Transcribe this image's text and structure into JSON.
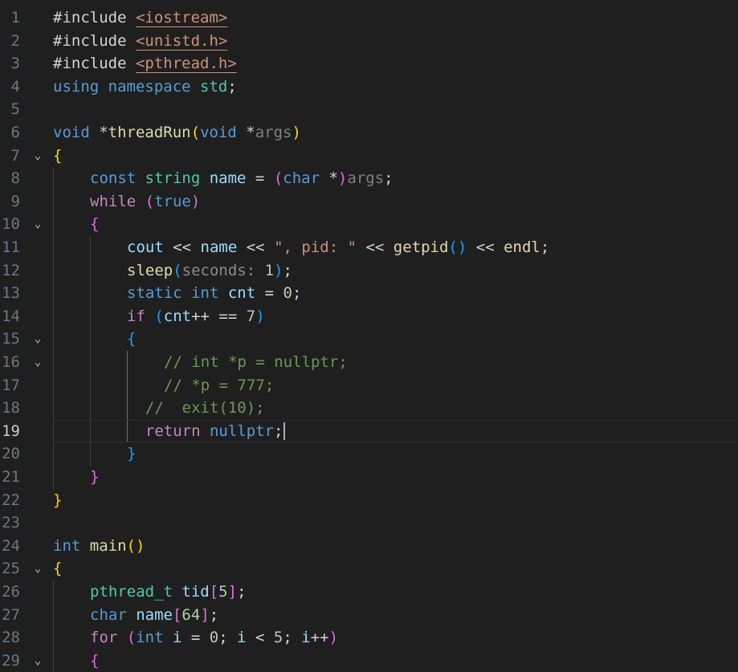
{
  "editor": {
    "language": "cpp",
    "cursor_line": 19,
    "lines": [
      {
        "n": "1",
        "fold": "",
        "indent": 0,
        "tokens": [
          {
            "t": "#include ",
            "c": "plain"
          },
          {
            "t": "<iostream>",
            "c": "inc"
          }
        ]
      },
      {
        "n": "2",
        "fold": "",
        "indent": 0,
        "tokens": [
          {
            "t": "#include ",
            "c": "plain"
          },
          {
            "t": "<unistd.h>",
            "c": "inc"
          }
        ]
      },
      {
        "n": "3",
        "fold": "",
        "indent": 0,
        "tokens": [
          {
            "t": "#include ",
            "c": "plain"
          },
          {
            "t": "<pthread.h>",
            "c": "inc"
          }
        ]
      },
      {
        "n": "4",
        "fold": "",
        "indent": 0,
        "tokens": [
          {
            "t": "using ",
            "c": "kw"
          },
          {
            "t": "namespace ",
            "c": "kw"
          },
          {
            "t": "std",
            "c": "ty"
          },
          {
            "t": ";",
            "c": "plain"
          }
        ]
      },
      {
        "n": "5",
        "fold": "",
        "indent": 0,
        "tokens": []
      },
      {
        "n": "6",
        "fold": "",
        "indent": 0,
        "tokens": [
          {
            "t": "void ",
            "c": "kw"
          },
          {
            "t": "*",
            "c": "plain"
          },
          {
            "t": "threadRun",
            "c": "fn"
          },
          {
            "t": "(",
            "c": "b1"
          },
          {
            "t": "void ",
            "c": "kw"
          },
          {
            "t": "*",
            "c": "plain"
          },
          {
            "t": "args",
            "c": "par"
          },
          {
            "t": ")",
            "c": "b1"
          }
        ]
      },
      {
        "n": "7",
        "fold": "⌄",
        "indent": 0,
        "tokens": [
          {
            "t": "{",
            "c": "b1"
          }
        ]
      },
      {
        "n": "8",
        "fold": "",
        "indent": 1,
        "tokens": [
          {
            "t": "const ",
            "c": "kw"
          },
          {
            "t": "string ",
            "c": "ty"
          },
          {
            "t": "name ",
            "c": "id"
          },
          {
            "t": "= ",
            "c": "plain"
          },
          {
            "t": "(",
            "c": "b2"
          },
          {
            "t": "char ",
            "c": "kw"
          },
          {
            "t": "*",
            "c": "plain"
          },
          {
            "t": ")",
            "c": "b2"
          },
          {
            "t": "args",
            "c": "par"
          },
          {
            "t": ";",
            "c": "plain"
          }
        ]
      },
      {
        "n": "9",
        "fold": "",
        "indent": 1,
        "tokens": [
          {
            "t": "while ",
            "c": "ctl"
          },
          {
            "t": "(",
            "c": "b2"
          },
          {
            "t": "true",
            "c": "kw"
          },
          {
            "t": ")",
            "c": "b2"
          }
        ]
      },
      {
        "n": "10",
        "fold": "⌄",
        "indent": 1,
        "tokens": [
          {
            "t": "{",
            "c": "b2"
          }
        ]
      },
      {
        "n": "11",
        "fold": "",
        "indent": 2,
        "tokens": [
          {
            "t": "cout ",
            "c": "id"
          },
          {
            "t": "<< ",
            "c": "plain"
          },
          {
            "t": "name ",
            "c": "id"
          },
          {
            "t": "<< ",
            "c": "plain"
          },
          {
            "t": "\", pid: \" ",
            "c": "str"
          },
          {
            "t": "<< ",
            "c": "plain"
          },
          {
            "t": "getpid",
            "c": "fn"
          },
          {
            "t": "()",
            "c": "b3"
          },
          {
            "t": " << ",
            "c": "plain"
          },
          {
            "t": "endl",
            "c": "fn"
          },
          {
            "t": ";",
            "c": "plain"
          }
        ]
      },
      {
        "n": "12",
        "fold": "",
        "indent": 2,
        "tokens": [
          {
            "t": "sleep",
            "c": "fn"
          },
          {
            "t": "(",
            "c": "b3"
          },
          {
            "t": "seconds: ",
            "c": "hint"
          },
          {
            "t": "1",
            "c": "num"
          },
          {
            "t": ")",
            "c": "b3"
          },
          {
            "t": ";",
            "c": "plain"
          }
        ]
      },
      {
        "n": "13",
        "fold": "",
        "indent": 2,
        "tokens": [
          {
            "t": "static ",
            "c": "kw"
          },
          {
            "t": "int ",
            "c": "kw"
          },
          {
            "t": "cnt ",
            "c": "id"
          },
          {
            "t": "= ",
            "c": "plain"
          },
          {
            "t": "0",
            "c": "num"
          },
          {
            "t": ";",
            "c": "plain"
          }
        ]
      },
      {
        "n": "14",
        "fold": "",
        "indent": 2,
        "tokens": [
          {
            "t": "if ",
            "c": "ctl"
          },
          {
            "t": "(",
            "c": "b3"
          },
          {
            "t": "cnt",
            "c": "id"
          },
          {
            "t": "++ == ",
            "c": "plain"
          },
          {
            "t": "7",
            "c": "num"
          },
          {
            "t": ")",
            "c": "b3"
          }
        ]
      },
      {
        "n": "15",
        "fold": "⌄",
        "indent": 2,
        "tokens": [
          {
            "t": "{",
            "c": "b3"
          }
        ]
      },
      {
        "n": "16",
        "fold": "⌄",
        "indent": 3,
        "tokens": [
          {
            "t": "// int *p = nullptr;",
            "c": "cm"
          }
        ]
      },
      {
        "n": "17",
        "fold": "",
        "indent": 3,
        "tokens": [
          {
            "t": "// *p = 777;",
            "c": "cm"
          }
        ]
      },
      {
        "n": "18",
        "fold": "",
        "indent": 2,
        "tokens": [
          {
            "t": "  //  exit(10);",
            "c": "cm"
          }
        ]
      },
      {
        "n": "19",
        "fold": "",
        "indent": 2,
        "tokens": [
          {
            "t": "  return ",
            "c": "ctl"
          },
          {
            "t": "nullptr",
            "c": "kw"
          },
          {
            "t": ";",
            "c": "plain"
          }
        ]
      },
      {
        "n": "20",
        "fold": "",
        "indent": 2,
        "tokens": [
          {
            "t": "}",
            "c": "b3"
          }
        ]
      },
      {
        "n": "21",
        "fold": "",
        "indent": 1,
        "tokens": [
          {
            "t": "}",
            "c": "b2"
          }
        ]
      },
      {
        "n": "22",
        "fold": "",
        "indent": 0,
        "tokens": [
          {
            "t": "}",
            "c": "b1"
          }
        ]
      },
      {
        "n": "23",
        "fold": "",
        "indent": 0,
        "tokens": []
      },
      {
        "n": "24",
        "fold": "",
        "indent": 0,
        "tokens": [
          {
            "t": "int ",
            "c": "kw"
          },
          {
            "t": "main",
            "c": "fn"
          },
          {
            "t": "()",
            "c": "b1"
          }
        ]
      },
      {
        "n": "25",
        "fold": "⌄",
        "indent": 0,
        "tokens": [
          {
            "t": "{",
            "c": "b1"
          }
        ]
      },
      {
        "n": "26",
        "fold": "",
        "indent": 1,
        "tokens": [
          {
            "t": "pthread_t ",
            "c": "ty"
          },
          {
            "t": "tid",
            "c": "id"
          },
          {
            "t": "[",
            "c": "b2"
          },
          {
            "t": "5",
            "c": "num"
          },
          {
            "t": "]",
            "c": "b2"
          },
          {
            "t": ";",
            "c": "plain"
          }
        ]
      },
      {
        "n": "27",
        "fold": "",
        "indent": 1,
        "tokens": [
          {
            "t": "char ",
            "c": "kw"
          },
          {
            "t": "name",
            "c": "id"
          },
          {
            "t": "[",
            "c": "b2"
          },
          {
            "t": "64",
            "c": "num"
          },
          {
            "t": "]",
            "c": "b2"
          },
          {
            "t": ";",
            "c": "plain"
          }
        ]
      },
      {
        "n": "28",
        "fold": "",
        "indent": 1,
        "tokens": [
          {
            "t": "for ",
            "c": "ctl"
          },
          {
            "t": "(",
            "c": "b2"
          },
          {
            "t": "int ",
            "c": "kw"
          },
          {
            "t": "i ",
            "c": "id"
          },
          {
            "t": "= ",
            "c": "plain"
          },
          {
            "t": "0",
            "c": "num"
          },
          {
            "t": "; ",
            "c": "plain"
          },
          {
            "t": "i ",
            "c": "id"
          },
          {
            "t": "< ",
            "c": "plain"
          },
          {
            "t": "5",
            "c": "num"
          },
          {
            "t": "; ",
            "c": "plain"
          },
          {
            "t": "i",
            "c": "id"
          },
          {
            "t": "++",
            "c": "plain"
          },
          {
            "t": ")",
            "c": "b2"
          }
        ]
      },
      {
        "n": "29",
        "fold": "⌄",
        "indent": 1,
        "tokens": [
          {
            "t": "{",
            "c": "b2"
          }
        ]
      }
    ]
  }
}
